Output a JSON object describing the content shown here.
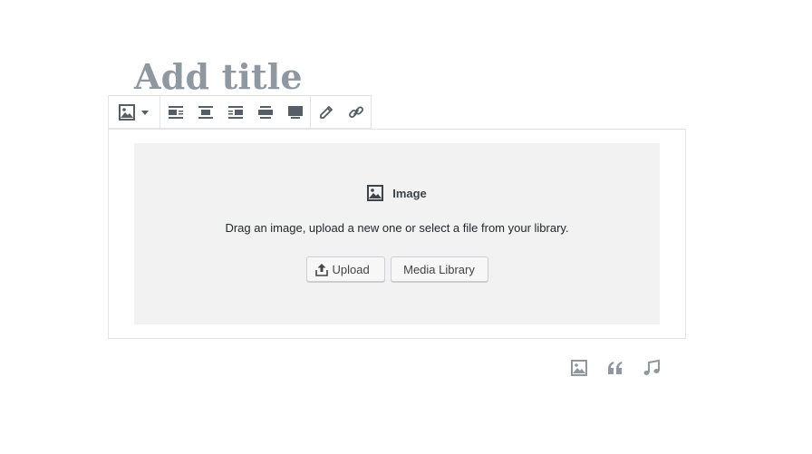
{
  "editor": {
    "title_placeholder": "Add title"
  },
  "toolbar": {
    "block_switcher_icon": "image-icon",
    "alignment_icons": [
      "align-left-icon",
      "align-center-icon",
      "align-right-icon",
      "align-wide-icon",
      "align-full-icon"
    ],
    "edit_icon": "pencil-icon",
    "link_icon": "link-icon"
  },
  "image_block": {
    "label": "Image",
    "instructions": "Drag an image, upload a new one or select a file from your library.",
    "upload_label": "Upload",
    "media_library_label": "Media Library"
  },
  "inserter": {
    "icons": [
      "image-icon",
      "quote-icon",
      "audio-icon"
    ]
  },
  "colors": {
    "title": "#8f98a1",
    "icon": "#555d66",
    "placeholder_bg": "#f2f2f2",
    "border": "#e2e4e7"
  }
}
